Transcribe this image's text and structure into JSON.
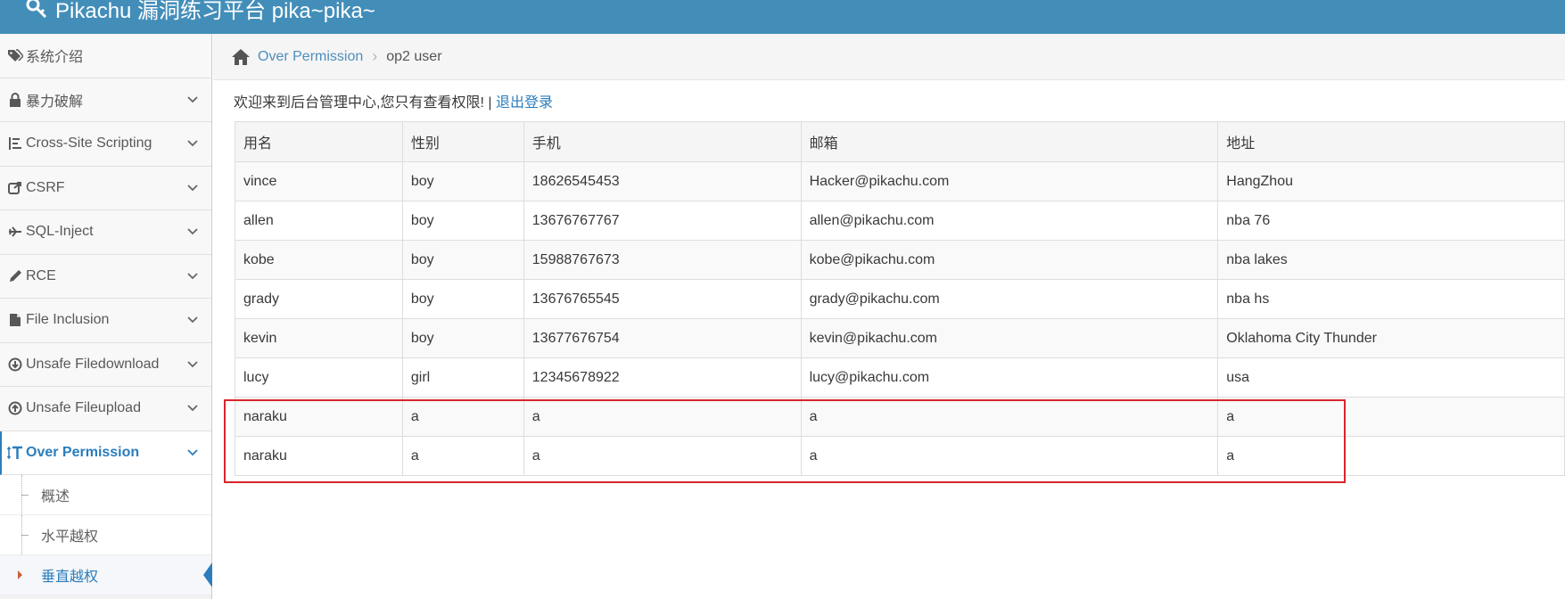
{
  "header": {
    "title": "Pikachu 漏洞练习平台 pika~pika~"
  },
  "sidebar": {
    "items": [
      {
        "label": "系统介绍",
        "icon": "tags-icon",
        "expandable": false
      },
      {
        "label": "暴力破解",
        "icon": "lock-icon",
        "expandable": true
      },
      {
        "label": "Cross-Site Scripting",
        "icon": "list-tree-icon",
        "expandable": true
      },
      {
        "label": "CSRF",
        "icon": "share-icon",
        "expandable": true
      },
      {
        "label": "SQL-Inject",
        "icon": "plane-icon",
        "expandable": true
      },
      {
        "label": "RCE",
        "icon": "pencil-icon",
        "expandable": true
      },
      {
        "label": "File Inclusion",
        "icon": "file-icon",
        "expandable": true
      },
      {
        "label": "Unsafe Filedownload",
        "icon": "download-circle-icon",
        "expandable": true
      },
      {
        "label": "Unsafe Fileupload",
        "icon": "upload-circle-icon",
        "expandable": true
      },
      {
        "label": "Over Permission",
        "icon": "text-height-icon",
        "expandable": true,
        "active": true
      }
    ],
    "subitems": [
      {
        "label": "概述"
      },
      {
        "label": "水平越权"
      },
      {
        "label": "垂直越权",
        "active": true
      }
    ]
  },
  "breadcrumb": {
    "parent": "Over Permission",
    "current": "op2 user"
  },
  "welcome": {
    "text": "欢迎来到后台管理中心,您只有查看权限! | ",
    "logout": "退出登录"
  },
  "table": {
    "headers": [
      "用名",
      "性别",
      "手机",
      "邮箱",
      "地址"
    ],
    "rows": [
      [
        "vince",
        "boy",
        "18626545453",
        "Hacker@pikachu.com",
        "HangZhou"
      ],
      [
        "allen",
        "boy",
        "13676767767",
        "allen@pikachu.com",
        "nba 76"
      ],
      [
        "kobe",
        "boy",
        "15988767673",
        "kobe@pikachu.com",
        "nba lakes"
      ],
      [
        "grady",
        "boy",
        "13676765545",
        "grady@pikachu.com",
        "nba hs"
      ],
      [
        "kevin",
        "boy",
        "13677676754",
        "kevin@pikachu.com",
        "Oklahoma City Thunder"
      ],
      [
        "lucy",
        "girl",
        "12345678922",
        "lucy@pikachu.com",
        "usa"
      ],
      [
        "naraku",
        "a",
        "a",
        "a",
        "a"
      ],
      [
        "naraku",
        "a",
        "a",
        "a",
        "a"
      ]
    ]
  },
  "colors": {
    "header_bg": "#438eb9",
    "accent": "#2b7dbc",
    "highlight": "#d9252c"
  }
}
